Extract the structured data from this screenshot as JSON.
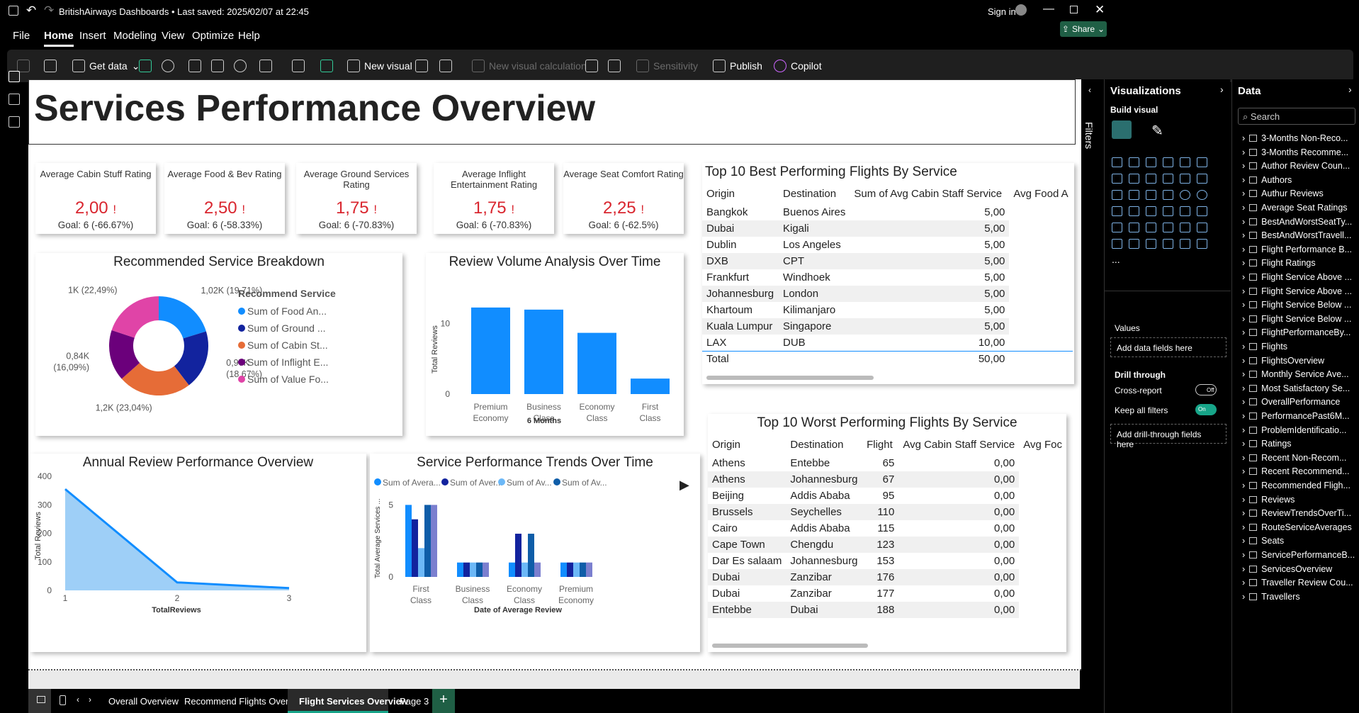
{
  "titlebar": {
    "title": "BritishAirways Dashboards • Last saved: 2025/02/07 at 22:45",
    "sign_in": "Sign in"
  },
  "menu": {
    "tabs": [
      "File",
      "Home",
      "Insert",
      "Modeling",
      "View",
      "Optimize",
      "Help"
    ],
    "share": "Share"
  },
  "toolbar": {
    "get_data": "Get data",
    "new_visual": "New visual",
    "new_visual_calc": "New visual calculation",
    "sensitivity": "Sensitivity",
    "publish": "Publish",
    "copilot": "Copilot"
  },
  "report": {
    "title": "Services Performance Overview"
  },
  "kpis": [
    {
      "label": "Average Cabin Stuff Rating",
      "value": "2,00",
      "goal": "Goal: 6 (-66.67%)"
    },
    {
      "label": "Average Food & Bev Rating",
      "value": "2,50",
      "goal": "Goal: 6 (-58.33%)"
    },
    {
      "label": "Average Ground Services Rating",
      "value": "1,75",
      "goal": "Goal: 6 (-70.83%)"
    },
    {
      "label": "Average Inflight Entertainment Rating",
      "value": "1,75",
      "goal": "Goal: 6 (-70.83%)"
    },
    {
      "label": "Average Seat Comfort Rating",
      "value": "2,25",
      "goal": "Goal: 6 (-62.5%)"
    }
  ],
  "best_table": {
    "title": "Top 10 Best Performing Flights By Service",
    "columns": [
      "Origin",
      "Destination",
      "Sum of Avg Cabin Staff Service",
      "Avg Food A"
    ],
    "rows": [
      [
        "Bangkok",
        "Buenos Aires",
        "5,00"
      ],
      [
        "Dubai",
        "Kigali",
        "5,00"
      ],
      [
        "Dublin",
        "Los Angeles",
        "5,00"
      ],
      [
        "DXB",
        "CPT",
        "5,00"
      ],
      [
        "Frankfurt",
        "Windhoek",
        "5,00"
      ],
      [
        "Johannesburg",
        "London",
        "5,00"
      ],
      [
        "Khartoum",
        "Kilimanjaro",
        "5,00"
      ],
      [
        "Kuala Lumpur",
        "Singapore",
        "5,00"
      ],
      [
        "LAX",
        "DUB",
        "10,00"
      ]
    ],
    "total_label": "Total",
    "total_value": "50,00"
  },
  "worst_table": {
    "title": "Top 10 Worst Performing Flights By Service",
    "columns": [
      "Origin",
      "Destination",
      "Flight",
      "Avg Cabin Staff Service",
      "Avg Foc"
    ],
    "rows": [
      [
        "Athens",
        "Entebbe",
        "65",
        "0,00"
      ],
      [
        "Athens",
        "Johannesburg",
        "67",
        "0,00"
      ],
      [
        "Beijing",
        "Addis Ababa",
        "95",
        "0,00"
      ],
      [
        "Brussels",
        "Seychelles",
        "110",
        "0,00"
      ],
      [
        "Cairo",
        "Addis Ababa",
        "115",
        "0,00"
      ],
      [
        "Cape Town",
        "Chengdu",
        "123",
        "0,00"
      ],
      [
        "Dar Es salaam",
        "Johannesburg",
        "153",
        "0,00"
      ],
      [
        "Dubai",
        "Zanzibar",
        "176",
        "0,00"
      ],
      [
        "Dubai",
        "Zanzibar",
        "177",
        "0,00"
      ],
      [
        "Entebbe",
        "Dubai",
        "188",
        "0,00"
      ]
    ]
  },
  "chart_data": [
    {
      "id": "donut",
      "type": "pie",
      "title": "Recommended Service Breakdown",
      "legend_title": "Recommend Service",
      "series": [
        {
          "name": "Sum of Food An...",
          "value": 1020,
          "label": "1,02K (19,71%)",
          "color": "#118DFF"
        },
        {
          "name": "Sum of Ground ...",
          "value": 970,
          "label": "0,97K (18,67%)",
          "color": "#12239E"
        },
        {
          "name": "Sum of Cabin St...",
          "value": 1200,
          "label": "1,2K (23,04%)",
          "color": "#E66C37"
        },
        {
          "name": "Sum of Inflight E...",
          "value": 840,
          "label": "0,84K (16,09%)",
          "color": "#6B007B"
        },
        {
          "name": "Sum of Value Fo...",
          "value": 1000,
          "label": "1K (22,49%)",
          "color": "#E044A7"
        }
      ]
    },
    {
      "id": "volume",
      "type": "bar",
      "title": "Review Volume Analysis Over Time",
      "xlabel": "6 Months",
      "ylabel": "Total Reviews",
      "categories": [
        "Premium Economy",
        "Business Class",
        "Economy Class",
        "First Class"
      ],
      "values": [
        12.3,
        12.0,
        8.7,
        2.2
      ],
      "ylim": [
        0,
        14
      ],
      "yticks": [
        0,
        10
      ],
      "color": "#118DFF"
    },
    {
      "id": "annual",
      "type": "area",
      "title": "Annual Review Performance Overview",
      "xlabel": "TotalReviews",
      "ylabel": "Total Reviews",
      "x": [
        1,
        2,
        3
      ],
      "values": [
        355,
        28,
        8
      ],
      "ylim": [
        0,
        400
      ],
      "yticks": [
        0,
        100,
        200,
        300,
        400
      ],
      "color": "#118DFF",
      "fill": "#9ECFF7"
    },
    {
      "id": "trends",
      "type": "bar",
      "title": "Service Performance Trends Over Time",
      "xlabel": "Date of Average Review",
      "ylabel": "Total Average Services ...",
      "categories": [
        "First Class",
        "Business Class",
        "Economy Class",
        "Premium Economy"
      ],
      "series": [
        {
          "name": "Sum of Avera...",
          "color": "#118DFF",
          "values": [
            5,
            1,
            1,
            1
          ]
        },
        {
          "name": "Sum of Aver...",
          "color": "#12239E",
          "values": [
            4,
            1,
            3,
            1
          ]
        },
        {
          "name": "Sum of Av...",
          "color": "#6CB8F7",
          "values": [
            2,
            1,
            1,
            1
          ]
        },
        {
          "name": "Sum of Av...",
          "color": "#0F5DA8",
          "values": [
            5,
            1,
            3,
            1
          ]
        },
        {
          "name": "",
          "color": "#7B7FCF",
          "values": [
            5,
            1,
            1,
            1
          ]
        }
      ],
      "ylim": [
        0,
        6.2
      ],
      "yticks": [
        0,
        5
      ]
    }
  ],
  "viz": {
    "title": "Visualizations",
    "build": "Build visual",
    "values": "Values",
    "add_data": "Add data fields here",
    "drill": "Drill through",
    "cross": "Cross-report",
    "cross_state": "Off",
    "keep": "Keep all filters",
    "keep_state": "On",
    "add_drill": "Add drill-through fields here"
  },
  "data": {
    "title": "Data",
    "search": "Search",
    "items": [
      "3-Months Non-Reco...",
      "3-Months Recomme...",
      "Author Review Coun...",
      "Authors",
      "Authur Reviews",
      "Average Seat Ratings",
      "BestAndWorstSeatTy...",
      "BestAndWorstTravell...",
      "Flight Performance B...",
      "Flight Ratings",
      "Flight Service Above ...",
      "Flight Service Above ...",
      "Flight Service Below ...",
      "Flight Service Below ...",
      "FlightPerformanceBy...",
      "Flights",
      "FlightsOverview",
      "Monthly Service Ave...",
      "Most Satisfactory Se...",
      "OverallPerformance",
      "PerformancePast6M...",
      "ProblemIdentificatio...",
      "Ratings",
      "Recent Non-Recom...",
      "Recent Recommend...",
      "Recommended Fligh...",
      "Reviews",
      "ReviewTrendsOverTi...",
      "RouteServiceAverages",
      "Seats",
      "ServicePerformanceB...",
      "ServicesOverview",
      "Traveller Review Cou...",
      "Travellers"
    ]
  },
  "filters": {
    "label": "Filters"
  },
  "pages": [
    "Overall Overview",
    "Recommend Flights Overview",
    "Flight Services Overview",
    "Page 3"
  ],
  "active_page": "Flight Services Overview"
}
